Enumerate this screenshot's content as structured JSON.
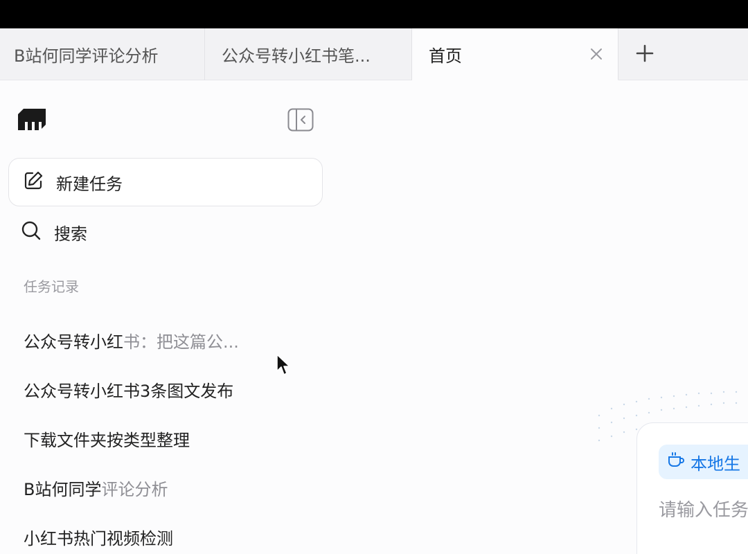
{
  "tabs": [
    {
      "label": "B站何同学评论分析"
    },
    {
      "label": "公众号转小红书笔..."
    },
    {
      "label": "首页",
      "active": true
    }
  ],
  "sidebar": {
    "new_task_label": "新建任务",
    "search_label": "搜索",
    "section_title": "任务记录",
    "history": [
      {
        "strong": "公众号转小红",
        "muted": "书：把这篇公..."
      },
      {
        "strong": "公众号转小红书3条图文发布",
        "muted": ""
      },
      {
        "strong": "下载文件夹按类型整理",
        "muted": ""
      },
      {
        "strong": "B站何同学",
        "muted": "评论分析"
      },
      {
        "strong": "小红书热门视频检测",
        "muted": ""
      }
    ]
  },
  "main": {
    "chip_label": "本地生",
    "input_placeholder": "请输入任务"
  },
  "colors": {
    "accent": "#1677e6",
    "chip_bg": "#e6f3ff",
    "muted_text": "#8f8f95"
  }
}
